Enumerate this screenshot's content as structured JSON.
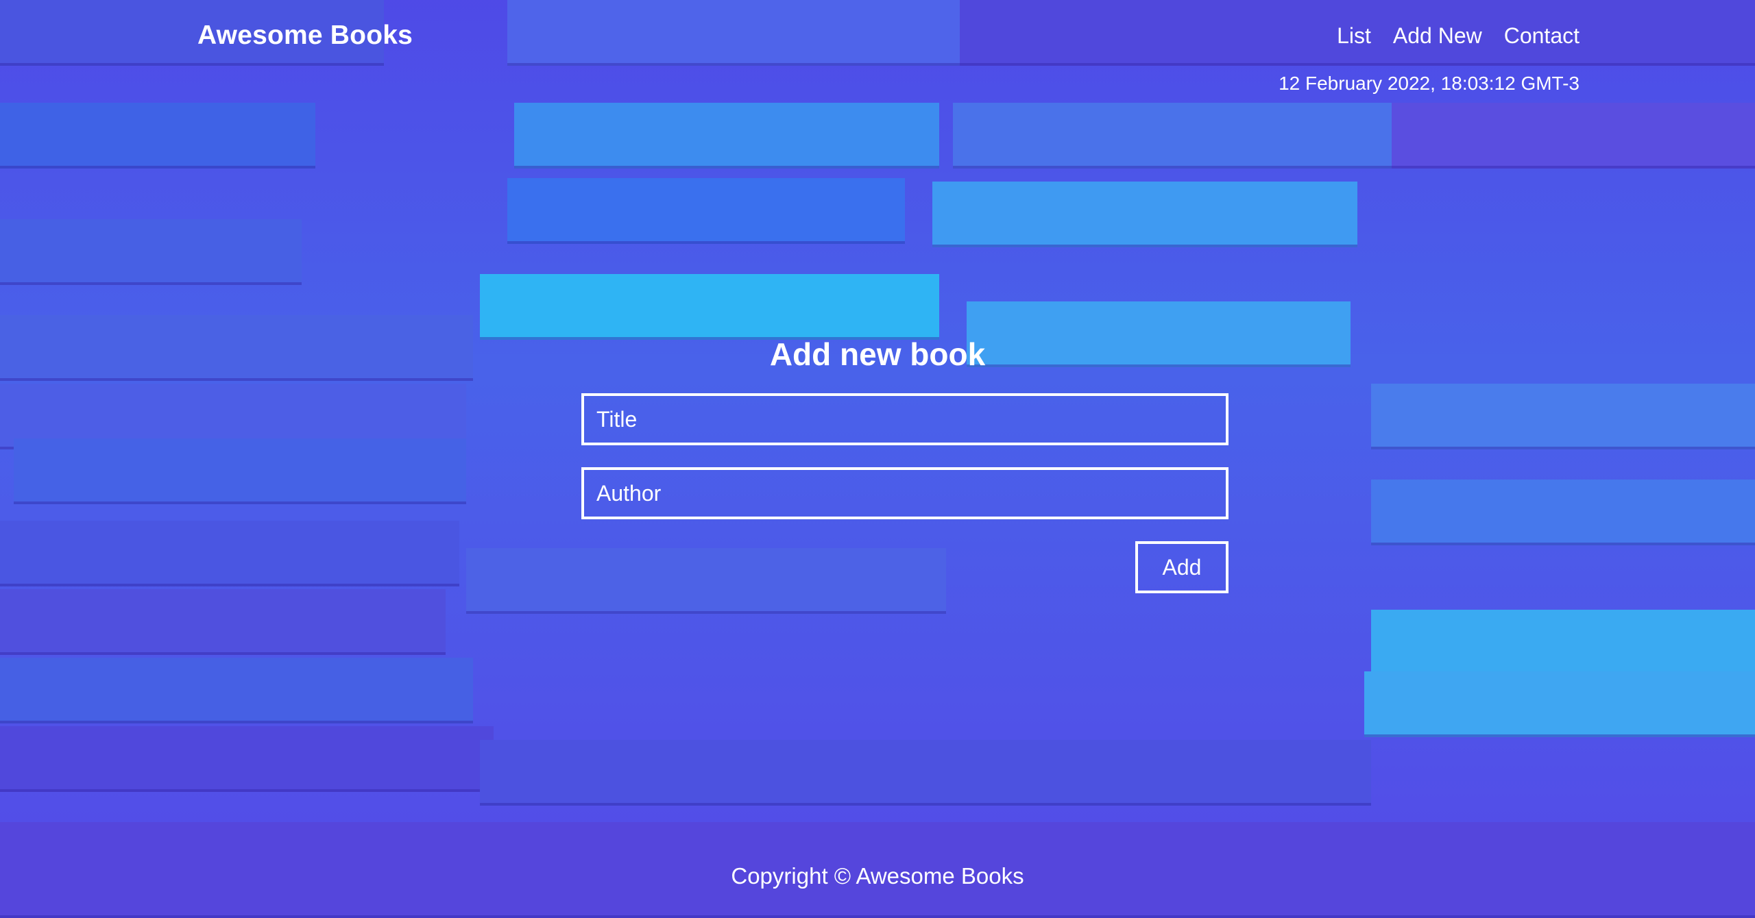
{
  "header": {
    "brand": "Awesome Books",
    "nav": {
      "list": "List",
      "add_new": "Add New",
      "contact": "Contact"
    },
    "datetime": "12 February 2022, 18:03:12 GMT-3"
  },
  "form": {
    "title": "Add new book",
    "title_placeholder": "Title",
    "author_placeholder": "Author",
    "add_label": "Add"
  },
  "footer": {
    "copyright": "Copyright © Awesome Books"
  },
  "colors": {
    "background": "#4d5be8",
    "text": "#ffffff"
  }
}
